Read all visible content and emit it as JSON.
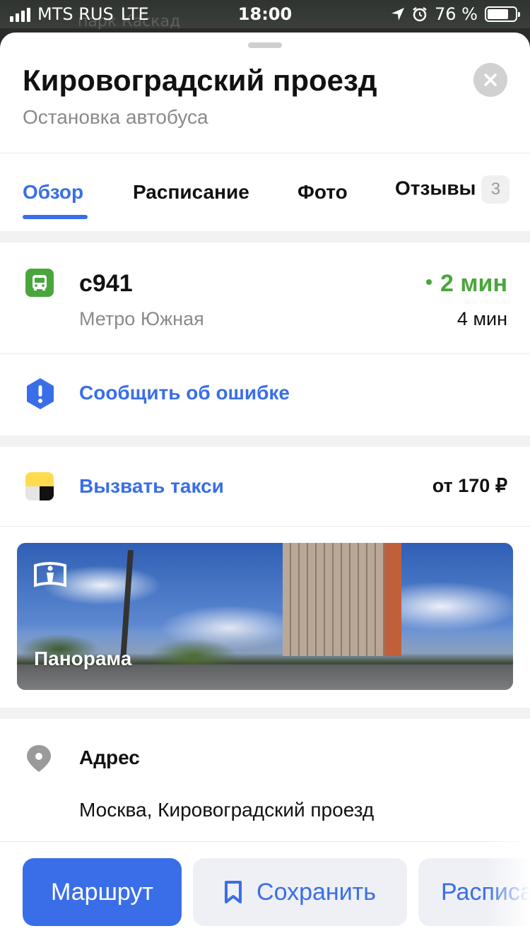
{
  "status_bar": {
    "carrier": "MTS RUS",
    "network": "LTE",
    "time": "18:00",
    "battery_percent": "76 %",
    "battery_level": 0.76
  },
  "map_hint": "парк Каскад",
  "header": {
    "title": "Кировоградский проезд",
    "subtitle": "Остановка автобуса"
  },
  "tabs": [
    {
      "label": "Обзор",
      "active": true
    },
    {
      "label": "Расписание",
      "active": false
    },
    {
      "label": "Фото",
      "active": false
    },
    {
      "label": "Отзывы",
      "badge": "3",
      "active": false
    }
  ],
  "route": {
    "number": "с941",
    "destination": "Метро Южная",
    "eta_main": "2 мин",
    "eta_next": "4 мин",
    "icon": "bus-icon",
    "color": "#4aa63c"
  },
  "report_error": {
    "label": "Сообщить об ошибке",
    "icon": "alert-hexagon-icon"
  },
  "taxi": {
    "label": "Вызвать такси",
    "price": "от 170 ₽",
    "icon": "yandex-taxi-icon"
  },
  "panorama": {
    "label": "Панорама",
    "icon": "panorama-icon"
  },
  "address": {
    "label": "Адрес",
    "value": "Москва, Кировоградский проезд",
    "icon": "location-pin-icon"
  },
  "actions": {
    "route_label": "Маршрут",
    "save_label": "Сохранить",
    "schedule_label": "Расписание"
  },
  "colors": {
    "accent": "#3a6ee8",
    "green": "#4aa63c",
    "taxi_yellow": "#ffdb4d"
  }
}
